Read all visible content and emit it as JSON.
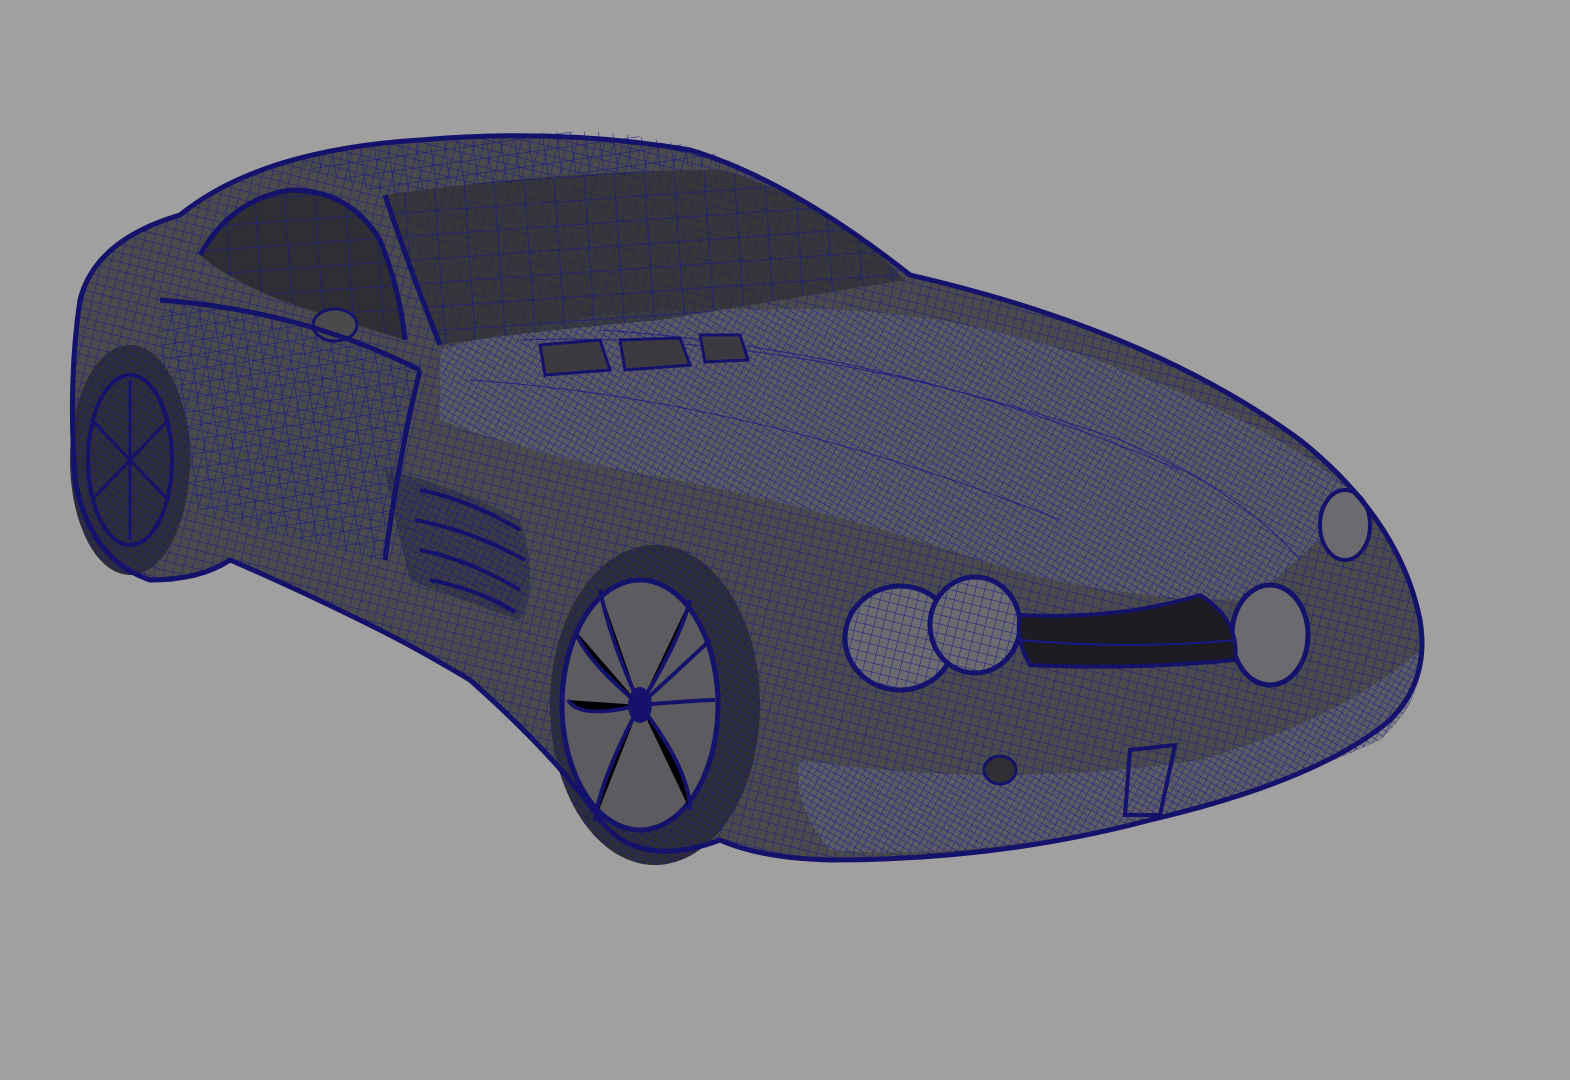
{
  "viewport": {
    "background_color": "#a0a0a0",
    "display_mode": "wireframe-on-shaded",
    "wireframe_color": "#1a1a8a",
    "shaded_color": "#4a4a4c"
  },
  "scene": {
    "object": "sports-car-model"
  }
}
